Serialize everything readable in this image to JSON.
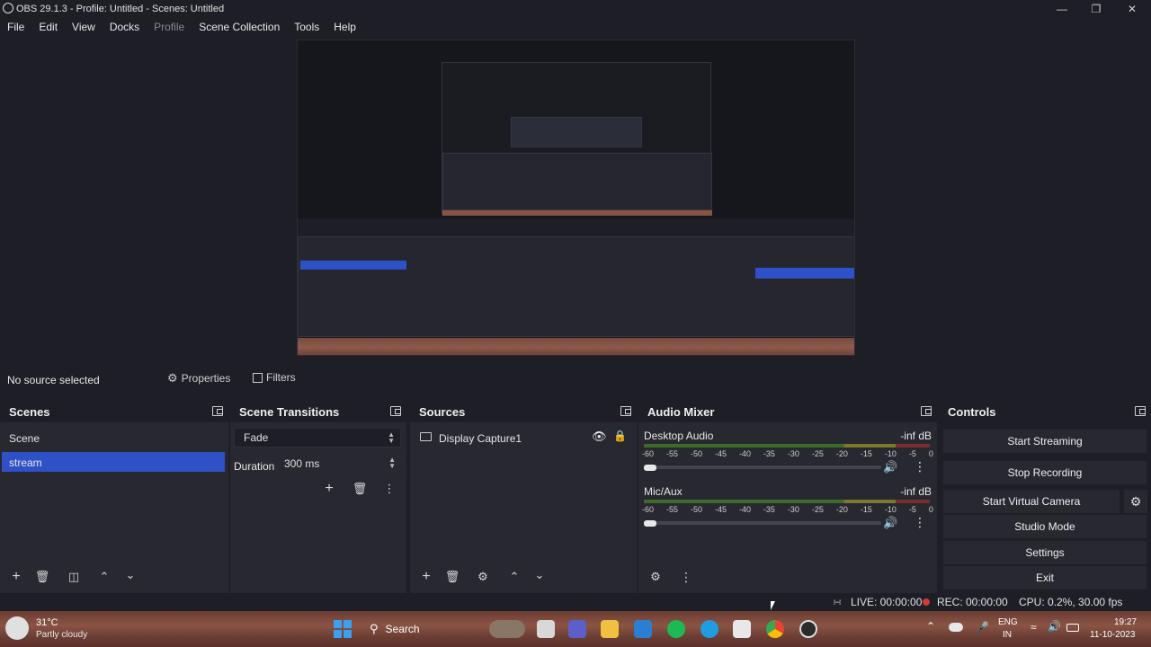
{
  "window": {
    "title": "OBS 29.1.3 - Profile: Untitled - Scenes: Untitled"
  },
  "menu": [
    "File",
    "Edit",
    "View",
    "Docks",
    "Profile",
    "Scene Collection",
    "Tools",
    "Help"
  ],
  "source_bar": {
    "status": "No source selected",
    "properties": "Properties",
    "filters": "Filters"
  },
  "scenes": {
    "title": "Scenes",
    "items": [
      "Scene",
      "stream"
    ],
    "selected": "stream"
  },
  "transitions": {
    "title": "Scene Transitions",
    "type": "Fade",
    "duration_label": "Duration",
    "duration_value": "300 ms"
  },
  "sources": {
    "title": "Sources",
    "items": [
      "Display Capture1"
    ]
  },
  "mixer": {
    "title": "Audio Mixer",
    "channels": [
      {
        "name": "Desktop Audio",
        "level": "-inf dB"
      },
      {
        "name": "Mic/Aux",
        "level": "-inf dB"
      }
    ],
    "scale": [
      "-60",
      "-55",
      "-50",
      "-45",
      "-40",
      "-35",
      "-30",
      "-25",
      "-20",
      "-15",
      "-10",
      "-5",
      "0"
    ]
  },
  "controls": {
    "title": "Controls",
    "start_streaming": "Start Streaming",
    "stop_recording": "Stop Recording",
    "start_virtual_camera": "Start Virtual Camera",
    "studio_mode": "Studio Mode",
    "settings": "Settings",
    "exit": "Exit"
  },
  "status": {
    "live": "LIVE: 00:00:00",
    "rec": "REC: 00:00:00",
    "cpu": "CPU: 0.2%, 30.00 fps"
  },
  "taskbar": {
    "weather_temp": "31°C",
    "weather_text": "Partly cloudy",
    "search": "Search",
    "lang_top": "ENG",
    "lang_bottom": "IN",
    "time": "19:27",
    "date": "11-10-2023"
  },
  "colors": {
    "accent": "#2e51c8",
    "bg": "#1e1f26",
    "panel": "#272830"
  }
}
